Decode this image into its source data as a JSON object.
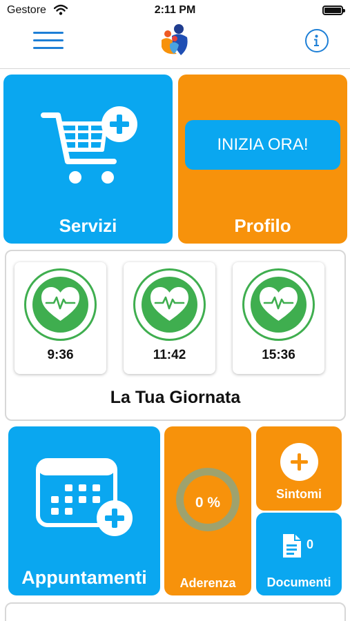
{
  "status_bar": {
    "carrier": "Gestore",
    "time": "2:11 PM"
  },
  "nav": {
    "menu_icon": "hamburger-menu-icon",
    "info_icon": "info-icon",
    "accent": "#1d7fd6"
  },
  "tiles": {
    "servizi": {
      "label": "Servizi",
      "icon": "cart-plus-icon"
    },
    "profilo": {
      "label": "Profilo",
      "cta": "INIZIA ORA!"
    },
    "appuntamenti": {
      "label": "Appuntamenti",
      "icon": "calendar-plus-icon"
    },
    "aderenza": {
      "label": "Aderenza",
      "value": "0 %"
    },
    "sintomi": {
      "label": "Sintomi",
      "icon": "plus-circle-icon"
    },
    "documenti": {
      "label": "Documenti",
      "count": "0",
      "icon": "document-icon"
    }
  },
  "day": {
    "title": "La Tua Giornata",
    "entries": [
      {
        "time": "9:36",
        "icon": "heart-pulse-icon"
      },
      {
        "time": "11:42",
        "icon": "heart-pulse-icon"
      },
      {
        "time": "15:36",
        "icon": "heart-pulse-icon"
      }
    ]
  },
  "colors": {
    "blue": "#0aa7f0",
    "orange": "#f7920b",
    "green": "#3fae4f"
  }
}
